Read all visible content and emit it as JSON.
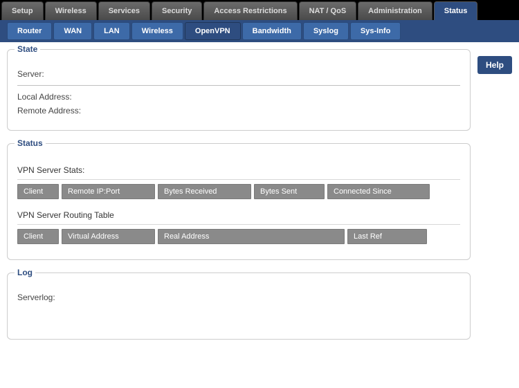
{
  "topTabs": [
    "Setup",
    "Wireless",
    "Services",
    "Security",
    "Access Restrictions",
    "NAT / QoS",
    "Administration",
    "Status"
  ],
  "topActive": 7,
  "subTabs": [
    "Router",
    "WAN",
    "LAN",
    "Wireless",
    "OpenVPN",
    "Bandwidth",
    "Syslog",
    "Sys-Info"
  ],
  "subActive": 4,
  "help": "Help",
  "state": {
    "legend": "State",
    "serverLabel": "Server:",
    "serverValue": "",
    "localLabel": "Local Address:",
    "localValue": "",
    "remoteLabel": "Remote Address:",
    "remoteValue": ""
  },
  "status": {
    "legend": "Status",
    "statsLabel": "VPN Server Stats:",
    "statsHeaders": [
      "Client",
      "Remote IP:Port",
      "Bytes Received",
      "Bytes Sent",
      "Connected Since"
    ],
    "routingLabel": "VPN Server Routing Table",
    "routingHeaders": [
      "Client",
      "Virtual Address",
      "Real Address",
      "Last Ref"
    ]
  },
  "log": {
    "legend": "Log",
    "serverlogLabel": "Serverlog:",
    "serverlogValue": ""
  },
  "colWidths": {
    "stats": [
      60,
      135,
      135,
      102,
      148
    ],
    "routing": [
      60,
      135,
      270,
      115
    ]
  }
}
